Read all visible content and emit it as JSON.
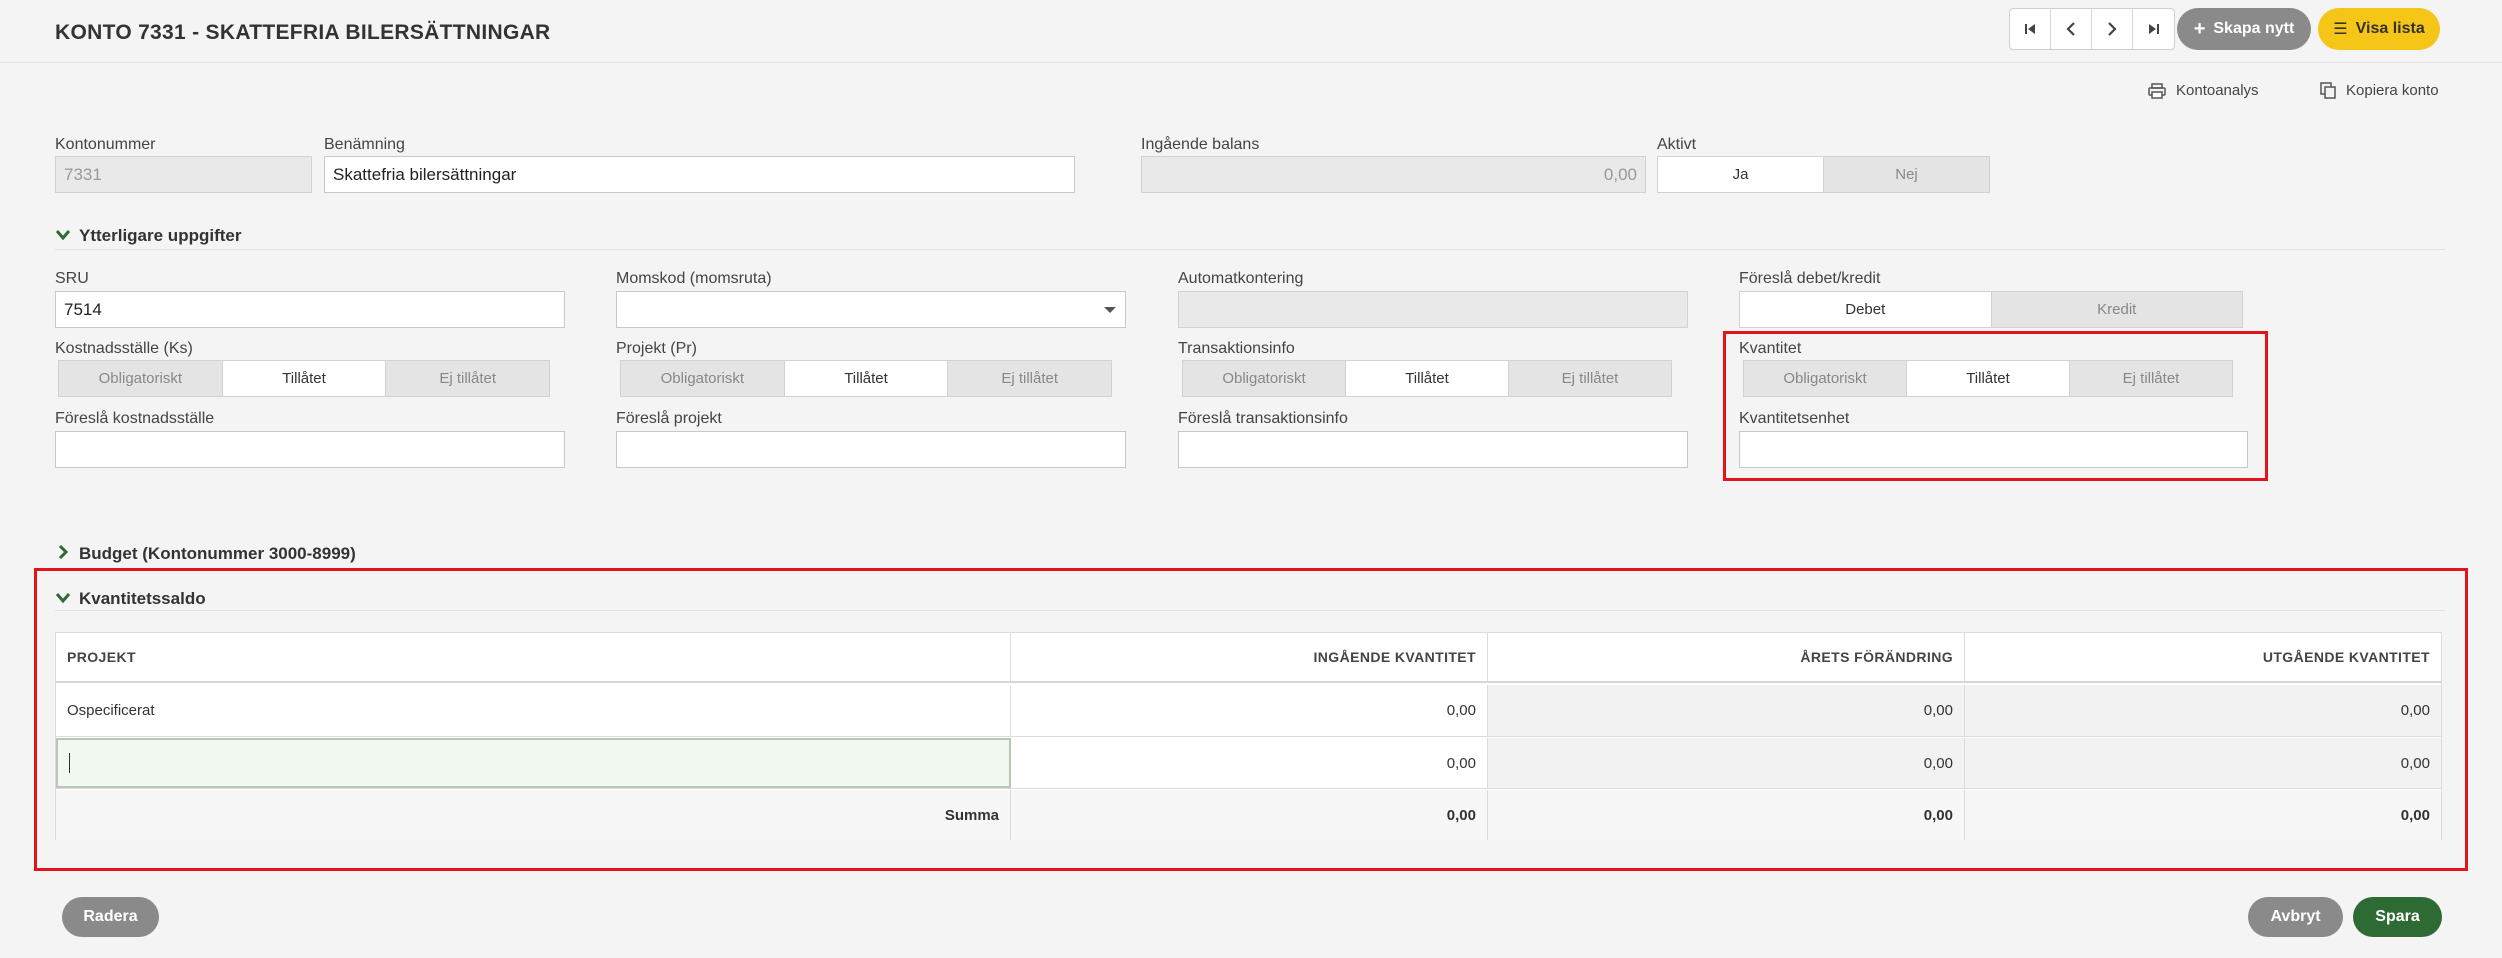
{
  "header": {
    "title": "KONTO 7331 - SKATTEFRIA BILERSÄTTNINGAR",
    "create_label": "Skapa nytt",
    "list_label": "Visa lista"
  },
  "toolbar": {
    "analysis_label": "Kontoanalys",
    "copy_label": "Kopiera konto"
  },
  "account": {
    "number_label": "Kontonummer",
    "number_value": "7331",
    "name_label": "Benämning",
    "name_value": "Skattefria bilersättningar",
    "balance_label": "Ingående balans",
    "balance_value": "0,00",
    "active_label": "Aktivt",
    "active_options": [
      "Ja",
      "Nej"
    ],
    "active_selected": "Ja"
  },
  "details": {
    "title": "Ytterligare uppgifter",
    "sru_label": "SRU",
    "sru_value": "7514",
    "vat_label": "Momskod (momsruta)",
    "vat_value": "",
    "auto_label": "Automatkontering",
    "auto_value": "",
    "debcred_label": "Föreslå debet/kredit",
    "debcred_options": [
      "Debet",
      "Kredit"
    ],
    "debcred_selected": "Debet",
    "ks_label": "Kostnadsställe (Ks)",
    "pr_label": "Projekt (Pr)",
    "trans_label": "Transaktionsinfo",
    "qty_label": "Kvantitet",
    "perm_options": [
      "Obligatoriskt",
      "Tillåtet",
      "Ej tillåtet"
    ],
    "perm_selected": "Tillåtet",
    "suggest_ks_label": "Föreslå kostnadsställe",
    "suggest_pr_label": "Föreslå projekt",
    "suggest_trans_label": "Föreslå transaktionsinfo",
    "unit_label": "Kvantitetsenhet"
  },
  "budget": {
    "title": "Budget (Kontonummer 3000-8999)"
  },
  "qty_balance": {
    "title": "Kvantitetssaldo",
    "columns": [
      "PROJEKT",
      "INGÅENDE KVANTITET",
      "ÅRETS FÖRÄNDRING",
      "UTGÅENDE KVANTITET"
    ],
    "rows": [
      [
        "Ospecificerat",
        "0,00",
        "0,00",
        "0,00"
      ],
      [
        "",
        "0,00",
        "0,00",
        "0,00"
      ]
    ],
    "sum_label": "Summa",
    "sum_values": [
      "0,00",
      "0,00",
      "0,00"
    ]
  },
  "footer": {
    "delete_label": "Radera",
    "cancel_label": "Avbryt",
    "save_label": "Spara"
  },
  "colors": {
    "accent_green": "#2e6b34",
    "accent_yellow": "#f5c518",
    "highlight_red": "#e2131b"
  }
}
